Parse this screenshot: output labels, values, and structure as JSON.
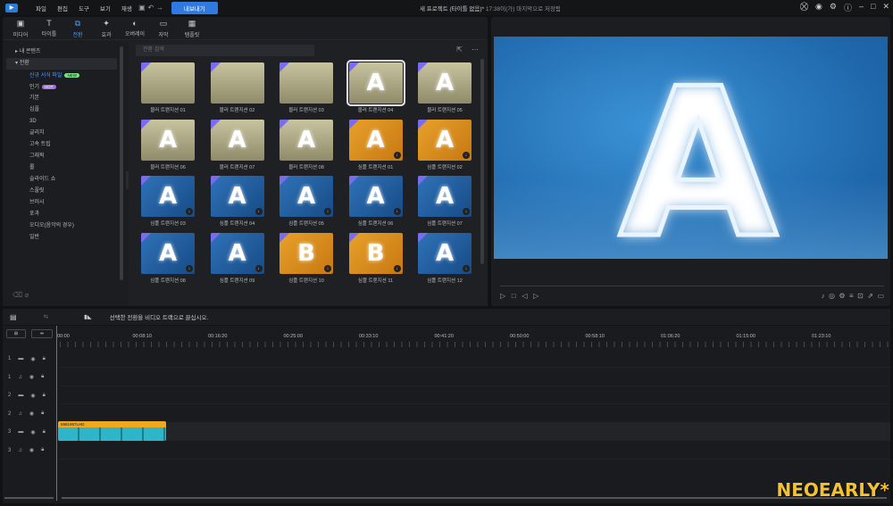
{
  "menu": {
    "items": [
      "파일",
      "편집",
      "도구",
      "보기",
      "재생"
    ],
    "export_label": "내보내기"
  },
  "title": {
    "project": "새 프로젝트 (타이틀 없음)*",
    "saved": "17:38이(가) 마지막으로 저장됨"
  },
  "tabs": [
    {
      "label": "미디어",
      "icon": "media-icon"
    },
    {
      "label": "타이틀",
      "icon": "title-icon"
    },
    {
      "label": "전환",
      "icon": "transition-icon",
      "active": true
    },
    {
      "label": "효과",
      "icon": "effects-icon"
    },
    {
      "label": "오버레이",
      "icon": "overlay-icon"
    },
    {
      "label": "자막",
      "icon": "subtitle-icon"
    },
    {
      "label": "템플릿",
      "icon": "template-icon"
    }
  ],
  "sidebar": {
    "my_content": "내 콘텐츠",
    "transition": "전환",
    "new_format": "신규 서식 파일",
    "new_badge": "NEW",
    "popular": "인기",
    "hot_badge": "HOT",
    "items": [
      "기본",
      "심플",
      "3D",
      "글리치",
      "고속 트립",
      "그래픽",
      "롤",
      "슬라이드 쇼",
      "스플릿",
      "브러시",
      "포과",
      "오디오(음악의 경우)",
      "일반"
    ]
  },
  "search": {
    "placeholder": "전환 검색"
  },
  "thumbnails": [
    {
      "label": "블러 트랜지션 01",
      "style": "blur",
      "glyph": ""
    },
    {
      "label": "블러 트랜지션 02",
      "style": "blur",
      "glyph": ""
    },
    {
      "label": "블러 트랜지션 03",
      "style": "blur",
      "glyph": ""
    },
    {
      "label": "블러 트랜지션 04",
      "style": "blur",
      "glyph": "A",
      "selected": true
    },
    {
      "label": "블러 트랜지션 05",
      "style": "blur",
      "glyph": "A"
    },
    {
      "label": "블러 트랜지션 06",
      "style": "blur",
      "glyph": "A"
    },
    {
      "label": "블러 트랜지션 07",
      "style": "blur",
      "glyph": "A"
    },
    {
      "label": "블러 트랜지션 08",
      "style": "blur",
      "glyph": "A"
    },
    {
      "label": "심플 트랜지션 01",
      "style": "orange",
      "glyph": "A",
      "download": true
    },
    {
      "label": "심플 트랜지션 02",
      "style": "orange",
      "glyph": "A",
      "download": true
    },
    {
      "label": "심플 트랜지션 03",
      "style": "simple",
      "glyph": "A",
      "download": true
    },
    {
      "label": "심플 트랜지션 04",
      "style": "simple",
      "glyph": "A",
      "download": true
    },
    {
      "label": "심플 트랜지션 05",
      "style": "simple",
      "glyph": "A",
      "download": true
    },
    {
      "label": "심플 트랜지션 06",
      "style": "simple",
      "glyph": "A",
      "download": true
    },
    {
      "label": "심플 트랜지션 07",
      "style": "simple",
      "glyph": "A",
      "download": true
    },
    {
      "label": "심플 트랜지션 08",
      "style": "simple",
      "glyph": "A",
      "download": true
    },
    {
      "label": "심플 트랜지션 09",
      "style": "simple",
      "glyph": "A",
      "download": true
    },
    {
      "label": "심플 트랜지션 10",
      "style": "orange",
      "glyph": "B",
      "download": true
    },
    {
      "label": "심플 트랜지션 11",
      "style": "orange",
      "glyph": "B",
      "download": true
    },
    {
      "label": "심플 트랜지션 12",
      "style": "simple",
      "glyph": "A",
      "download": true
    }
  ],
  "timeline": {
    "hint": "선택한 전환을 비디오 트랙으로 끌십시오.",
    "ticks": [
      "00:00",
      "00:08:10",
      "00:16:20",
      "00:25:00",
      "00:33:10",
      "00:41:20",
      "00:50:00",
      "00:58:10",
      "01:06:20",
      "01:15:00",
      "01:23:10"
    ],
    "tracks": [
      "1",
      "1",
      "2",
      "2",
      "3",
      "3"
    ],
    "clip_name": "5981997LHD"
  },
  "watermark": "NEOEARLY*",
  "colors": {
    "accent": "#2f7ae0",
    "active_tab": "#4d9dff",
    "playhead": "#e0463c",
    "clip_header": "#f0a81c"
  }
}
